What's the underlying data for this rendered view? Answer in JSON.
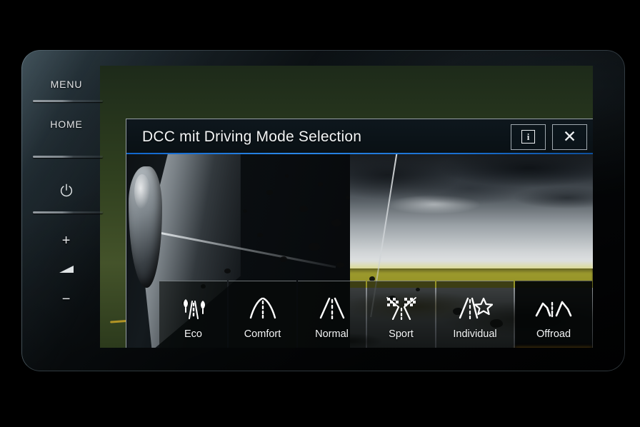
{
  "device": {
    "type": "infotainment-head-unit",
    "hard_keys": [
      {
        "name": "menu",
        "label": "MENU",
        "kind": "text"
      },
      {
        "name": "home",
        "label": "HOME",
        "kind": "text"
      },
      {
        "name": "power",
        "label": "",
        "kind": "icon",
        "icon": "power-icon"
      },
      {
        "name": "volume-up",
        "label": "+",
        "kind": "text"
      },
      {
        "name": "volume",
        "label": "",
        "kind": "icon",
        "icon": "volume-icon"
      },
      {
        "name": "volume-down",
        "label": "−",
        "kind": "text"
      }
    ]
  },
  "dialog": {
    "title": "DCC mit Driving Mode Selection",
    "info_button": {
      "label": "i",
      "name": "info-button"
    },
    "close_button": {
      "label": "✕",
      "name": "close-button"
    },
    "accent_color": "#f2a311",
    "rule_color": "#2a86e6"
  },
  "modes": [
    {
      "id": "eco",
      "label": "Eco",
      "icon": "eco-leaf-road-icon",
      "selected": false
    },
    {
      "id": "comfort",
      "label": "Comfort",
      "icon": "comfort-wide-road-icon",
      "selected": false
    },
    {
      "id": "normal",
      "label": "Normal",
      "icon": "normal-road-icon",
      "selected": false
    },
    {
      "id": "sport",
      "label": "Sport",
      "icon": "sport-flags-road-icon",
      "selected": false
    },
    {
      "id": "individual",
      "label": "Individual",
      "icon": "individual-star-road-icon",
      "selected": false
    },
    {
      "id": "offroad",
      "label": "Offroad",
      "icon": "offroad-mountain-icon",
      "selected": true
    }
  ]
}
